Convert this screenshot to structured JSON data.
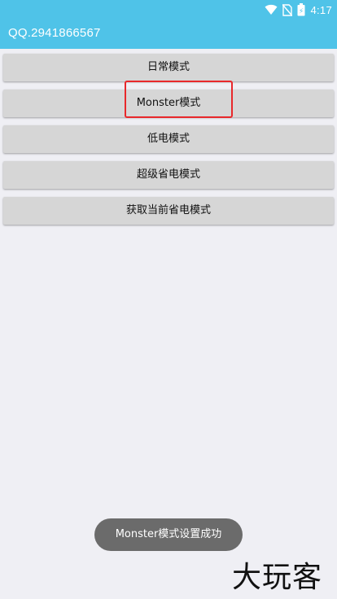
{
  "status_bar": {
    "time": "4:17",
    "battery_badge": "⚡",
    "icons": [
      "wifi-icon",
      "no-sim-icon",
      "battery-icon"
    ]
  },
  "app_bar": {
    "title": "QQ.2941866567"
  },
  "buttons": [
    {
      "label": "日常模式"
    },
    {
      "label": "Monster模式"
    },
    {
      "label": "低电模式"
    },
    {
      "label": "超级省电模式"
    },
    {
      "label": "获取当前省电模式"
    }
  ],
  "toast": {
    "message": "Monster模式设置成功"
  },
  "watermark": {
    "text": "大玩客"
  },
  "colors": {
    "app_bar": "#4fc3e8",
    "background": "#efeff4",
    "button": "#d6d6d6",
    "highlight": "#e8282b",
    "toast": "#6b6b6b"
  }
}
